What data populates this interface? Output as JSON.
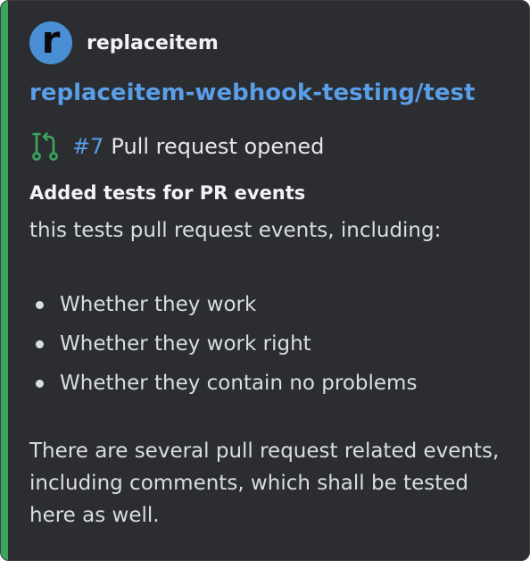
{
  "colors": {
    "accent": "#3ba55c",
    "background": "#2b2d31",
    "link": "#5a9ee8",
    "avatar_bg": "#4a8fd6"
  },
  "author": {
    "avatar_letter": "r",
    "name": "replaceitem"
  },
  "repo": {
    "title": "replaceitem-webhook-testing/test"
  },
  "event": {
    "icon": "pull-request-icon",
    "number": "#7",
    "label": "Pull request opened"
  },
  "pr": {
    "title": "Added tests for PR events",
    "intro": "this tests pull request events, including:",
    "bullets": [
      "Whether they work",
      "Whether they work right",
      "Whether they contain no problems"
    ],
    "closing": "There are several pull request related events, including comments, which shall be tested here as well."
  }
}
